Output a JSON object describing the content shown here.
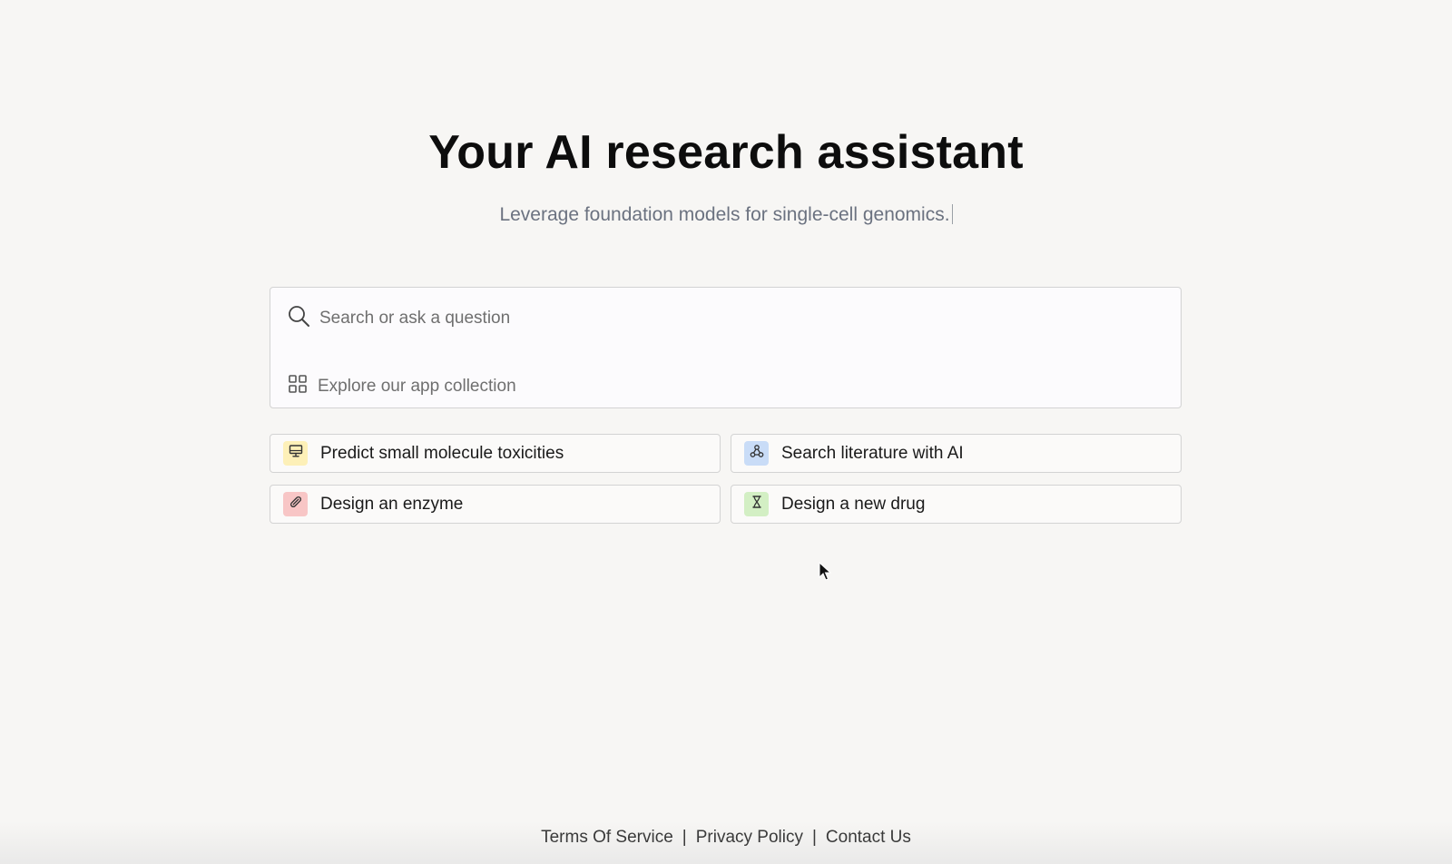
{
  "hero": {
    "title": "Your AI research assistant",
    "subtitle": "Leverage foundation models for single-cell genomics."
  },
  "search": {
    "placeholder": "Search or ask a question",
    "value": "",
    "icon": "search-icon"
  },
  "explore": {
    "label": "Explore our app collection",
    "icon": "grid-icon"
  },
  "suggestions": [
    {
      "label": "Predict small molecule toxicities",
      "icon": "monitor-icon",
      "color": "#fdf0b8"
    },
    {
      "label": "Search literature with AI",
      "icon": "webhook-icon",
      "color": "#c9dcf7"
    },
    {
      "label": "Design an enzyme",
      "icon": "pill-icon",
      "color": "#f8c6c6"
    },
    {
      "label": "Design a new drug",
      "icon": "hourglass-icon",
      "color": "#d3efc4"
    }
  ],
  "footer": {
    "terms": "Terms Of Service",
    "privacy": "Privacy Policy",
    "contact": "Contact Us",
    "separator": "|"
  }
}
